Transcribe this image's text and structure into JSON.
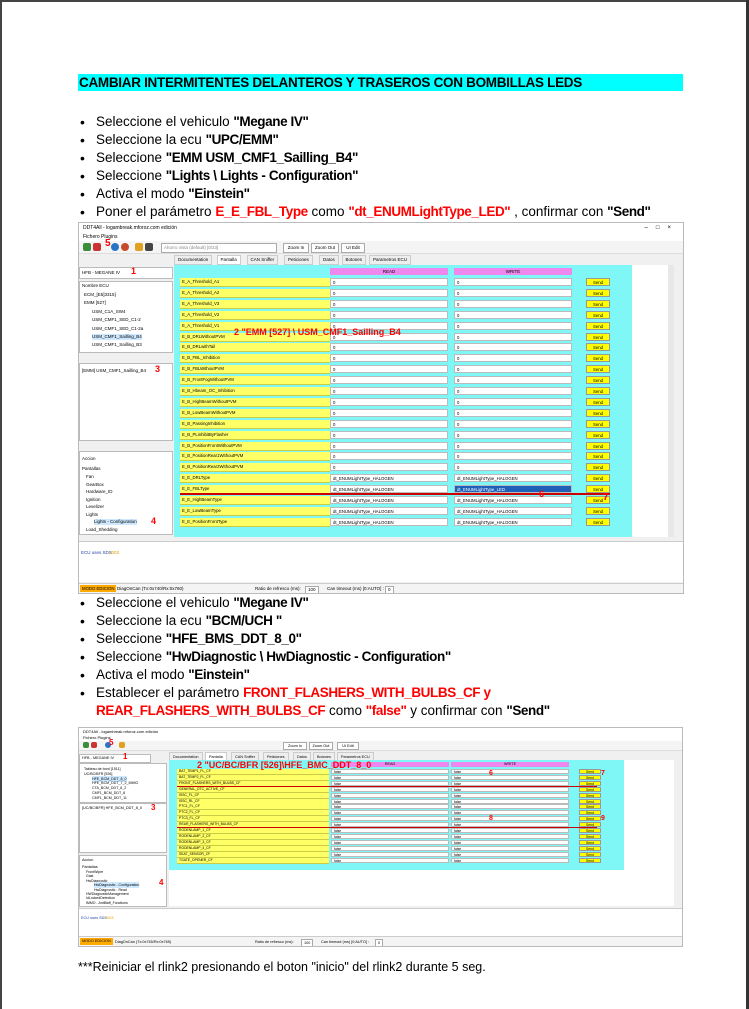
{
  "title": "CAMBIAR INTERMITENTES DELANTEROS Y TRASEROS CON BOMBILLAS LEDS",
  "section1": [
    {
      "pre": "Seleccione el vehiculo ",
      "bold": "\"Megane IV\"",
      "red": "",
      "mid": "",
      "bold2": "",
      "tail": "",
      "bold3": ""
    },
    {
      "pre": "Seleccione la ecu ",
      "bold": "\"UPC/EMM\"",
      "red": "",
      "mid": "",
      "bold2": "",
      "tail": "",
      "bold3": ""
    },
    {
      "pre": "Seleccione ",
      "bold": "\"EMM USM_CMF1_Sailling_B4\"",
      "red": "",
      "mid": "",
      "bold2": "",
      "tail": "",
      "bold3": ""
    },
    {
      "pre": "Seleccione ",
      "bold": "\"Lights \\ Lights - Configuration\"",
      "red": "",
      "mid": "",
      "bold2": "",
      "tail": "",
      "bold3": ""
    },
    {
      "pre": "Activa el modo ",
      "bold": "\"Einstein\"",
      "red": "",
      "mid": "",
      "bold2": "",
      "tail": "",
      "bold3": ""
    },
    {
      "pre": "Poner el parámetro ",
      "bold": "",
      "red": "E_E_FBL_Type",
      "mid": " como ",
      "bold2": "\"dt_ENUMLightType_LED\"",
      "tail": " , confirmar con ",
      "bold3": "\"Send\""
    }
  ],
  "section2": [
    {
      "pre": "Seleccione el vehiculo ",
      "bold": "\"Megane IV\""
    },
    {
      "pre": "Seleccione la ecu ",
      "bold": "\"BCM/UCH \""
    },
    {
      "pre": "Seleccione ",
      "bold": "\"HFE_BMS_DDT_8_0\""
    },
    {
      "pre": "Seleccione ",
      "bold": "\"HwDiagnostic \\ HwDiagnostic - Configuration\""
    },
    {
      "pre": "Activa el modo ",
      "bold": "\"Einstein\""
    }
  ],
  "section2_last": {
    "pre": "Establecer el parámetro ",
    "red1": "FRONT_FLASHERS_WITH_BULBS_CF y",
    "red2": "REAR_FLASHERS_WITH_BULBS_CF",
    "mid": " como ",
    "redq": "\"false\"",
    "tail": " y confirmar con ",
    "bold": "\"Send\""
  },
  "footer": "***Reiniciar el rlink2 presionando el boton \"inicio\" del rlink2 durante 5 seg.",
  "shot1": {
    "window_title": "DDT4All - logambreak.mforoz.com edición",
    "menu": "Fichero   Plugins",
    "combo": "Ahorro vista (default) [0/23]",
    "btn_zoomin": "Zoom In",
    "btn_zoomout": "Zoom Out",
    "btn_uiedit": "UI Edit",
    "vehicle_combo": "HFB - MEGANE IV",
    "tree_header": "Nombre ECU",
    "tree": [
      "ECM_[E5]3315]",
      "EMM [527]",
      "USM_C1A_SW4",
      "USM_CMF1_SED_C1-2",
      "USM_CMF1_SED_C1-2a",
      "USM_CMF1_Sailling_B4",
      "USM_CMF1_Sailling_B3"
    ],
    "selected_ecu": "[EMM] USM_CMF1_Sailling_B4",
    "accion": "Accion",
    "screens_header": "Pantallas",
    "screens": [
      "Fan",
      "GearBox",
      "Hardware_ID",
      "Ignition",
      "Levelizer",
      "Lights",
      "Lights - Configuration",
      "Load_Shedding"
    ],
    "tabs": [
      "Documentation",
      "Pantalla",
      "CAN Sniffer",
      "Peticiones",
      "Datos",
      "Botones",
      "Parametros ECU"
    ],
    "col_read": "READ",
    "col_write": "WRITE",
    "send": "Send",
    "rows": [
      {
        "name": "E_A_Threshold_A1",
        "read": "0",
        "write": "0"
      },
      {
        "name": "E_A_Threshold_A2",
        "read": "0",
        "write": "0"
      },
      {
        "name": "E_A_Threshold_V3",
        "read": "0",
        "write": "0"
      },
      {
        "name": "E_A_Threshold_V2",
        "read": "0",
        "write": "0"
      },
      {
        "name": "E_A_Threshold_V1",
        "read": "0",
        "write": "0"
      },
      {
        "name": "E_B_DRLWithoutPVM",
        "read": "0",
        "write": "0"
      },
      {
        "name": "E_B_DRLwithTail",
        "read": "0",
        "write": "0"
      },
      {
        "name": "E_B_FBL_Inhibition",
        "read": "0",
        "write": "0"
      },
      {
        "name": "E_B_FBLWithoutPVM",
        "read": "0",
        "write": "0"
      },
      {
        "name": "E_B_FrontFogWithoutPVM",
        "read": "0",
        "write": "0"
      },
      {
        "name": "E_B_Hbeam_OC_Inhibition",
        "read": "0",
        "write": "0"
      },
      {
        "name": "E_B_HighBeamWithoutPVM",
        "read": "0",
        "write": "0"
      },
      {
        "name": "E_B_LowBeamWithoutPVM",
        "read": "0",
        "write": "0"
      },
      {
        "name": "E_B_PassingInhibition",
        "read": "0",
        "write": "0"
      },
      {
        "name": "E_B_PLinhibitByFlasher",
        "read": "0",
        "write": "0"
      },
      {
        "name": "E_B_PositionFrontWithoutPVM",
        "read": "0",
        "write": "0"
      },
      {
        "name": "E_B_PositionRear1WithoutPVM",
        "read": "0",
        "write": "0"
      },
      {
        "name": "E_B_PositionRear2WithoutPVM",
        "read": "0",
        "write": "0"
      },
      {
        "name": "E_E_DRLType",
        "read": "dt_ENUMLightType_HALOGEN",
        "write": "dt_ENUMLightType_HALOGEN"
      },
      {
        "name": "E_E_FBLType",
        "read": "dt_ENUMLightType_HALOGEN",
        "write": "dt_ENUMLightType_LED"
      },
      {
        "name": "E_E_HighBeamType",
        "read": "dt_ENUMLightType_HALOGEN",
        "write": "dt_ENUMLightType_HALOGEN"
      },
      {
        "name": "E_E_LowBeamType",
        "read": "dt_ENUMLightType_HALOGEN",
        "write": "dt_ENUMLightType_HALOGEN"
      },
      {
        "name": "E_E_PositionFrontType",
        "read": "dt_ENUMLightType_HALOGEN",
        "write": "dt_ENUMLightType_HALOGEN"
      }
    ],
    "log": "ECU uses SDS",
    "log_value": "1003",
    "mode": "MODO EDICION",
    "status": "DiagOnCan (Tx:0x740/Rx:0x760)",
    "refresh_label": "Ratio de refresco (ms):",
    "refresh_value": "100",
    "can_timeout_label": "Can timeout (ms) [0:AUTO] :",
    "can_timeout_value": "0",
    "ann1": "1",
    "ann2": "2 \"EMM [527] \\ USM_CMF1_Sailling_B4",
    "ann3": "3",
    "ann4": "4",
    "ann5": "5",
    "ann6": "6",
    "ann7": "7"
  },
  "shot2": {
    "window_title": "DDT4All - logambreak.mforoz.com edición",
    "menu": "Fichero   Plugins",
    "btn_zoomin": "Zoom In",
    "btn_zoomout": "Zoom Out",
    "btn_uiedit": "UI Edit",
    "vehicle_combo": "HFB - MEGANE IV",
    "tree": [
      "Tableau de bord [1511]",
      "UC/BC/BFR [526]",
      "HFE_BCM_DDT_8_0",
      "HFE_BCM_DDT_7_2_IMMO",
      "CTA_BCM_DDT_6_2",
      "CMF1_BCM_DDT_8",
      "CMF1_BCM_DDT_11"
    ],
    "selected_ecu": "[UC/BC/BFR] HFE_BCM_DDT_8_0",
    "accion": "Accion",
    "screens_header": "Pantallas",
    "screens": [
      "FrontWiper",
      "Gast",
      "HwDiagnostic",
      "HwDiagnostic - Configuration",
      "HwDiagnostic - Read",
      "HWDiagnosticManagement",
      "IdLockedDetection",
      "IMMO - AntiBaff_Functions"
    ],
    "tabs": [
      "Documentation",
      "Pantalla",
      "CAN Sniffer",
      "Peticiones",
      "Datos",
      "Botones",
      "Parametros ECU"
    ],
    "col_read": "READ",
    "col_write": "WRITE",
    "send": "Send",
    "rows": [
      {
        "name": "BAT_TEMP1_FL_CF",
        "read": "false",
        "write": "false"
      },
      {
        "name": "BAT_TEMP2_FL_CF",
        "read": "false",
        "write": "false"
      },
      {
        "name": "FRONT_FLASHERS_WITH_BULBS_CF",
        "read": "false",
        "write": "false"
      },
      {
        "name": "GENERAL_DTC_ACTIVE_CF",
        "read": "false",
        "write": "false"
      },
      {
        "name": "ISSC_FL_CF",
        "read": "false",
        "write": "false"
      },
      {
        "name": "ISSC_RL_CF",
        "read": "false",
        "write": "false"
      },
      {
        "name": "PTC1_FL_CF",
        "read": "false",
        "write": "false"
      },
      {
        "name": "PTC2_FL_CF",
        "read": "false",
        "write": "false"
      },
      {
        "name": "PTC3_FL_CF",
        "read": "false",
        "write": "false"
      },
      {
        "name": "REAR_FLASHERS_WITH_BULBS_CF",
        "read": "false",
        "write": "false"
      },
      {
        "name": "RODENLAMP_1_CF",
        "read": "false",
        "write": "false"
      },
      {
        "name": "RODENLAMP_2_CF",
        "read": "false",
        "write": "false"
      },
      {
        "name": "RODENLAMP_3_CF",
        "read": "false",
        "write": "false"
      },
      {
        "name": "RODENLAMP_4_CF",
        "read": "false",
        "write": "false"
      },
      {
        "name": "SEAT_SENSOR_CF",
        "read": "false",
        "write": "false"
      },
      {
        "name": "TGATE_OPENER_CF",
        "read": "false",
        "write": "false"
      }
    ],
    "log": "ECU uses SDS",
    "log_value": "1003",
    "mode": "MODO EDICION",
    "status": "DiagOnCan (Tx:0x745/Rx:0x765)",
    "refresh_label": "Ratio de refresco (ms):",
    "refresh_value": "100",
    "can_timeout_label": "Can timeout (ms) [0:AUTO] :",
    "can_timeout_value": "0",
    "ann1": "1",
    "ann2": "2 \"UC/BC/BFR [526]\\HFE_BMC_DDT_8_0",
    "ann3": "3",
    "ann4": "4",
    "ann5": "5",
    "ann6": "6",
    "ann7": "7",
    "ann8": "8",
    "ann9": "9"
  }
}
